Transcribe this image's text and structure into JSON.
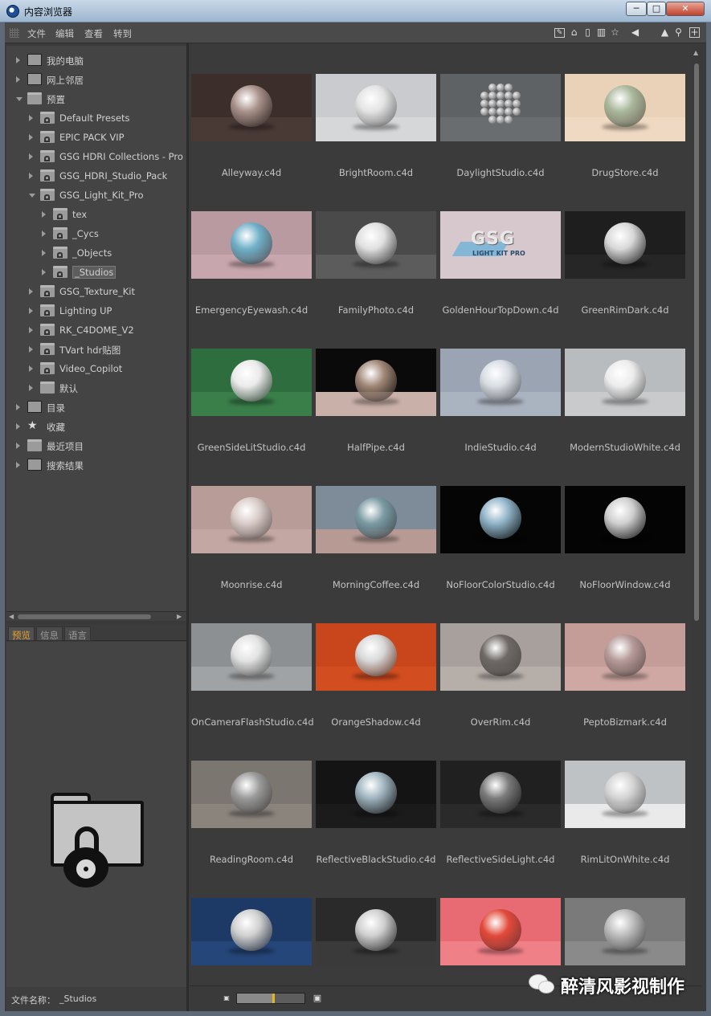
{
  "window": {
    "title": "内容浏览器",
    "buttons": {
      "minimize": "─",
      "maximize": "□",
      "close": "✕"
    }
  },
  "menubar": {
    "items": [
      "文件",
      "编辑",
      "查看",
      "转到"
    ],
    "toolbar_icons": [
      "edit-icon",
      "home-icon",
      "trash-icon",
      "book-icon",
      "star-icon",
      "back-arrow-icon",
      "up-arrow-icon",
      "search-icon",
      "add-icon"
    ]
  },
  "tree": {
    "items": [
      {
        "label": "我的电脑",
        "level": 0,
        "icon": "computer-icon"
      },
      {
        "label": "网上邻居",
        "level": 0,
        "icon": "network-icon"
      },
      {
        "label": "预置",
        "level": 0,
        "icon": "presets-icon",
        "expanded": true
      },
      {
        "label": "Default Presets",
        "level": 1,
        "icon": "locked-folder-icon"
      },
      {
        "label": "EPIC PACK VIP",
        "level": 1,
        "icon": "locked-folder-icon"
      },
      {
        "label": "GSG HDRI Collections - Pro St",
        "level": 1,
        "icon": "locked-folder-icon"
      },
      {
        "label": "GSG_HDRI_Studio_Pack",
        "level": 1,
        "icon": "locked-folder-icon"
      },
      {
        "label": "GSG_Light_Kit_Pro",
        "level": 1,
        "icon": "locked-folder-icon",
        "expanded": true
      },
      {
        "label": "tex",
        "level": 2,
        "icon": "locked-folder-icon"
      },
      {
        "label": "_Cycs",
        "level": 2,
        "icon": "locked-folder-icon"
      },
      {
        "label": "_Objects",
        "level": 2,
        "icon": "locked-folder-icon"
      },
      {
        "label": "_Studios",
        "level": 2,
        "icon": "locked-folder-icon",
        "selected": true
      },
      {
        "label": "GSG_Texture_Kit",
        "level": 1,
        "icon": "locked-folder-icon"
      },
      {
        "label": "Lighting UP",
        "level": 1,
        "icon": "locked-folder-icon"
      },
      {
        "label": "RK_C4DOME_V2",
        "level": 1,
        "icon": "locked-folder-icon"
      },
      {
        "label": "TVart hdr贴图",
        "level": 1,
        "icon": "locked-folder-icon"
      },
      {
        "label": "Video_Copilot",
        "level": 1,
        "icon": "locked-folder-icon"
      },
      {
        "label": "默认",
        "level": 1,
        "icon": "folder-icon"
      },
      {
        "label": "目录",
        "level": 0,
        "icon": "catalog-icon"
      },
      {
        "label": "收藏",
        "level": 0,
        "icon": "star-icon"
      },
      {
        "label": "最近项目",
        "level": 0,
        "icon": "folder-icon"
      },
      {
        "label": "搜索结果",
        "level": 0,
        "icon": "search-results-icon"
      }
    ]
  },
  "preview_tabs": [
    "预览",
    "信息",
    "语言"
  ],
  "preview": {
    "icon": "locked-folder-icon"
  },
  "file_name": {
    "label": "文件名称：",
    "value": "_Studios"
  },
  "thumbnails": [
    {
      "name": "Alleyway.c4d",
      "bg": "#3b2e2b",
      "floor": "#4a3a36",
      "sphere": "#a9918a"
    },
    {
      "name": "BrightRoom.c4d",
      "bg": "#c9cbce",
      "floor": "#d6d7d9",
      "sphere": "#e3e3e3"
    },
    {
      "name": "DaylightStudio.c4d",
      "bg": "#5f6265",
      "floor": "#6a6d70",
      "sphere": "cluster"
    },
    {
      "name": "DrugStore.c4d",
      "bg": "#ead2b8",
      "floor": "#f0d9c2",
      "sphere": "#a9b79a"
    },
    {
      "name": "EmergencyEyewash.c4d",
      "bg": "#b89aa0",
      "floor": "#c7a7ad",
      "sphere": "#6fb0c8"
    },
    {
      "name": "FamilyPhoto.c4d",
      "bg": "#4a4a4a",
      "floor": "#5c5c5c",
      "sphere": "#e0e0e0"
    },
    {
      "name": "GoldenHourTopDown.c4d",
      "bg": "#d6c8cc",
      "floor": "#d6c8cc",
      "sphere": "gsg",
      "logo_text": "GSG",
      "logo_sub": "LIGHT KIT PRO"
    },
    {
      "name": "GreenRimDark.c4d",
      "bg": "#1e1e1e",
      "floor": "#262626",
      "sphere": "#d8d8d8"
    },
    {
      "name": "GreenSideLitStudio.c4d",
      "bg": "#2e6e3e",
      "floor": "#3a7e4a",
      "sphere": "#eaeaea"
    },
    {
      "name": "HalfPipe.c4d",
      "bg": "#0a0a0a",
      "floor": "#c9b0a8",
      "sphere": "#a08676"
    },
    {
      "name": "IndieStudio.c4d",
      "bg": "#9aa4b2",
      "floor": "#aab3c0",
      "sphere": "#d8dde3"
    },
    {
      "name": "ModernStudioWhite.c4d",
      "bg": "#b9bcbf",
      "floor": "#c8cacc",
      "sphere": "#ececec"
    },
    {
      "name": "Moonrise.c4d",
      "bg": "#b89c98",
      "floor": "#c3a7a2",
      "sphere": "#d9ccc8"
    },
    {
      "name": "MorningCoffee.c4d",
      "bg": "#7d8c98",
      "floor": "#b79a94",
      "sphere": "#7a9aa2"
    },
    {
      "name": "NoFloorColorStudio.c4d",
      "bg": "#050505",
      "floor": "#050505",
      "sphere": "#8fb3c7"
    },
    {
      "name": "NoFloorWindow.c4d",
      "bg": "#040404",
      "floor": "#040404",
      "sphere": "#cfcfcf"
    },
    {
      "name": "OnCameraFlashStudio.c4d",
      "bg": "#8c9092",
      "floor": "#a0a3a5",
      "sphere": "#e2e2e2"
    },
    {
      "name": "OrangeShadow.c4d",
      "bg": "#c9461c",
      "floor": "#d24d20",
      "sphere": "#d8d8d8"
    },
    {
      "name": "OverRim.c4d",
      "bg": "#a7a09c",
      "floor": "#b5aea9",
      "sphere": "#6e6866"
    },
    {
      "name": "PeptoBizmark.c4d",
      "bg": "#c49c98",
      "floor": "#cfa8a3",
      "sphere": "#b59a98"
    },
    {
      "name": "ReadingRoom.c4d",
      "bg": "#7c7670",
      "floor": "#8a847d",
      "sphere": "#9a9a9a"
    },
    {
      "name": "ReflectiveBlackStudio.c4d",
      "bg": "#141414",
      "floor": "#1b1b1b",
      "sphere": "#9fb4bf"
    },
    {
      "name": "ReflectiveSideLight.c4d",
      "bg": "#202020",
      "floor": "#2a2a2a",
      "sphere": "#7b7b7b"
    },
    {
      "name": "RimLitOnWhite.c4d",
      "bg": "#bfc2c5",
      "floor": "#eaeaea",
      "sphere": "#d3d3d3"
    },
    {
      "name": "",
      "bg": "#1d3a66",
      "floor": "#254679",
      "sphere": "#d0d0d0"
    },
    {
      "name": "",
      "bg": "#2a2a2a",
      "floor": "#3a3a3a",
      "sphere": "#cfcfcf"
    },
    {
      "name": "",
      "bg": "#e86a72",
      "floor": "#f08088",
      "sphere": "#e24a3a"
    },
    {
      "name": "",
      "bg": "#7a7a7a",
      "floor": "#8a8a8a",
      "sphere": "#bcbcbc"
    }
  ],
  "bottom": {
    "zoom_fraction": 0.52
  },
  "watermark": {
    "text": "醉清风影视制作",
    "icon": "wechat-icon"
  }
}
